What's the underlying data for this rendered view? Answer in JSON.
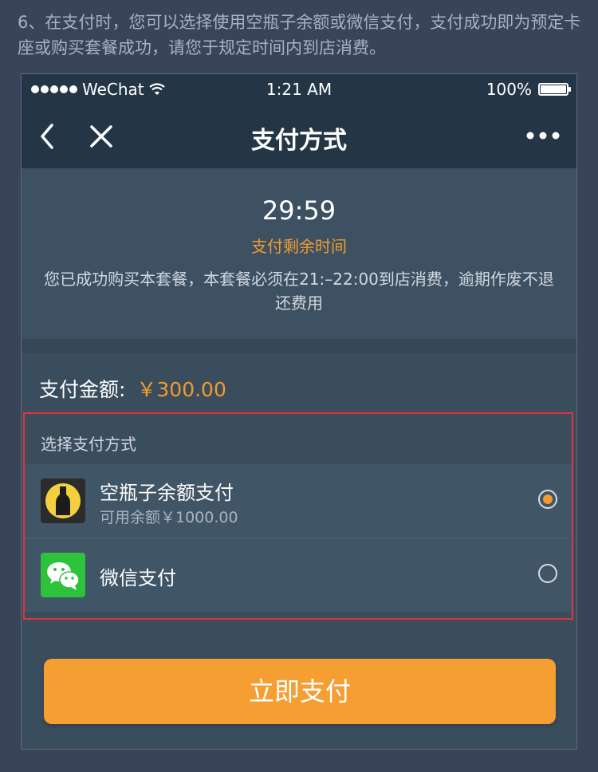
{
  "instruction": "6、在支付时，您可以选择使用空瓶子余额或微信支付，支付成功即为预定卡座或购买套餐成功，请您于规定时间内到店消费。",
  "status_bar": {
    "carrier": "WeChat",
    "time": "1:21 AM",
    "battery": "100%"
  },
  "nav": {
    "title": "支付方式",
    "icons": [
      "back-arrow-icon",
      "close-icon",
      "more-icon"
    ]
  },
  "timer": {
    "countdown": "29:59",
    "label": "支付剩余时间",
    "notice": "您已成功购买本套餐，本套餐必须在21:–22:00到店消费，逾期作废不退还费用"
  },
  "payment": {
    "amount_label": "支付金额:",
    "amount": "￥300.00"
  },
  "methods": {
    "header": "选择支付方式",
    "items": [
      {
        "name": "空瓶子余额支付",
        "sub": "可用余额￥1000.00",
        "icon": "bottle-logo-icon",
        "selected": true
      },
      {
        "name": "微信支付",
        "sub": "",
        "icon": "wechat-pay-icon",
        "selected": false
      }
    ]
  },
  "pay_button": "立即支付",
  "colors": {
    "accent": "#f39a2f",
    "highlight_border": "#e0333c",
    "navbar": "#243646",
    "wechat_green": "#2cc23c"
  }
}
